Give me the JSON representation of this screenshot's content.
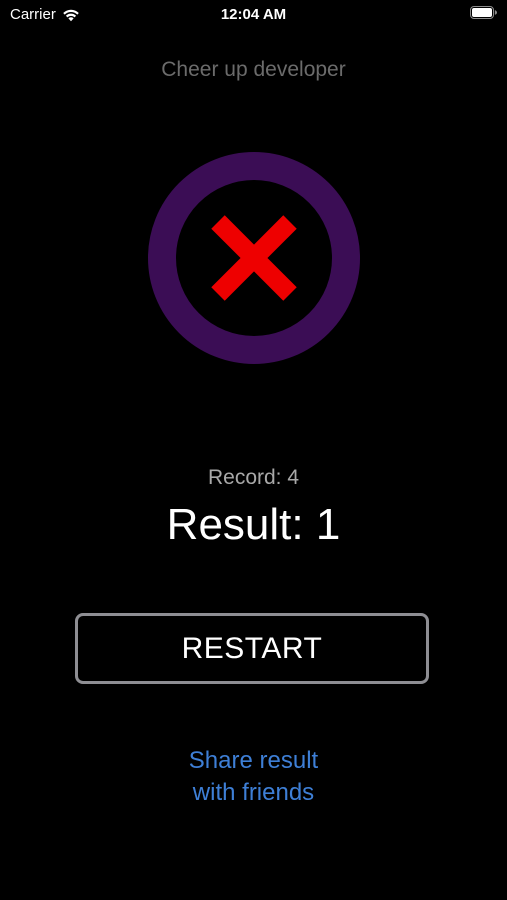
{
  "status_bar": {
    "carrier": "Carrier",
    "time": "12:04 AM",
    "icons": [
      "wifi-icon",
      "battery-icon"
    ]
  },
  "header": {
    "subtitle": "Cheer up developer"
  },
  "result_badge": {
    "icon": "cross-icon",
    "ring_color": "#3b0d55",
    "cross_color": "#ee0000"
  },
  "score": {
    "record_label": "Record: 4",
    "result_label": "Result: 1"
  },
  "actions": {
    "restart_label": "RESTART",
    "share_line1": "Share result",
    "share_line2": "with friends"
  },
  "colors": {
    "background": "#000000",
    "link": "#3e7fd6",
    "button_border": "#8e8e93"
  }
}
